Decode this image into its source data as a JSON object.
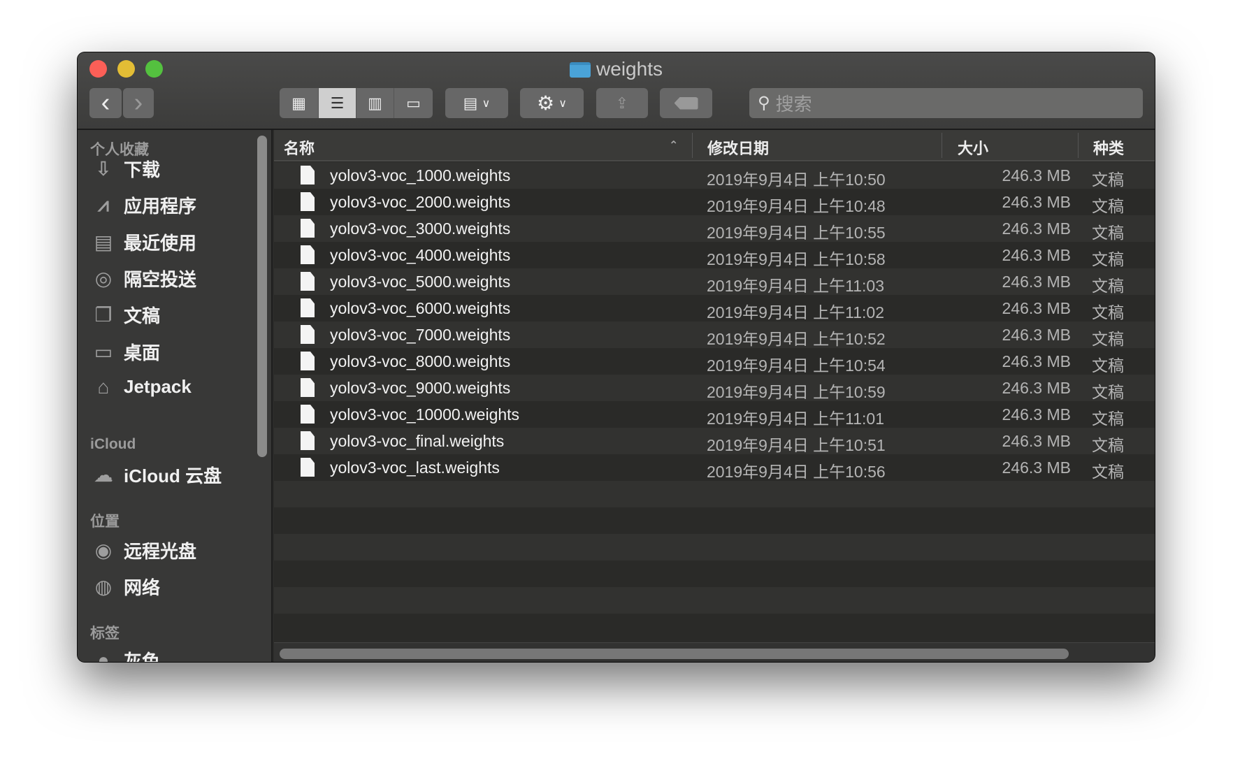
{
  "window": {
    "title": "weights",
    "traffic_lights": [
      "#fc5f57",
      "#e3bd35",
      "#54c13f"
    ]
  },
  "toolbar": {
    "back": "‹",
    "forward": "›",
    "views": [
      "icon-view",
      "list-view",
      "column-view",
      "gallery-view"
    ],
    "selected_view": "list-view",
    "arrange": "group-icon",
    "action": "gear-icon",
    "share": "share-icon",
    "tag": "tag-icon",
    "search_placeholder": "搜索"
  },
  "sidebar": {
    "favorites_heading": "个人收藏",
    "favorites": [
      {
        "label": "下载",
        "icon": "download-icon"
      },
      {
        "label": "应用程序",
        "icon": "applications-icon"
      },
      {
        "label": "最近使用",
        "icon": "recents-icon"
      },
      {
        "label": "隔空投送",
        "icon": "airdrop-icon"
      },
      {
        "label": "文稿",
        "icon": "documents-icon"
      },
      {
        "label": "桌面",
        "icon": "desktop-icon"
      },
      {
        "label": "Jetpack",
        "icon": "home-icon"
      }
    ],
    "icloud_heading": "iCloud",
    "icloud": [
      {
        "label": "iCloud 云盘",
        "icon": "cloud-icon"
      }
    ],
    "locations_heading": "位置",
    "locations": [
      {
        "label": "远程光盘",
        "icon": "disc-icon"
      },
      {
        "label": "网络",
        "icon": "network-icon"
      }
    ],
    "tags_heading": "标签",
    "tags": [
      {
        "label": "灰色",
        "icon": "gray-tag-icon"
      }
    ]
  },
  "columns": {
    "name": "名称",
    "date": "修改日期",
    "size": "大小",
    "kind": "种类",
    "sort": "name-ascending"
  },
  "files": [
    {
      "name": "yolov3-voc_1000.weights",
      "date": "2019年9月4日 上午10:50",
      "size": "246.3 MB",
      "kind": "文稿"
    },
    {
      "name": "yolov3-voc_2000.weights",
      "date": "2019年9月4日 上午10:48",
      "size": "246.3 MB",
      "kind": "文稿"
    },
    {
      "name": "yolov3-voc_3000.weights",
      "date": "2019年9月4日 上午10:55",
      "size": "246.3 MB",
      "kind": "文稿"
    },
    {
      "name": "yolov3-voc_4000.weights",
      "date": "2019年9月4日 上午10:58",
      "size": "246.3 MB",
      "kind": "文稿"
    },
    {
      "name": "yolov3-voc_5000.weights",
      "date": "2019年9月4日 上午11:03",
      "size": "246.3 MB",
      "kind": "文稿"
    },
    {
      "name": "yolov3-voc_6000.weights",
      "date": "2019年9月4日 上午11:02",
      "size": "246.3 MB",
      "kind": "文稿"
    },
    {
      "name": "yolov3-voc_7000.weights",
      "date": "2019年9月4日 上午10:52",
      "size": "246.3 MB",
      "kind": "文稿"
    },
    {
      "name": "yolov3-voc_8000.weights",
      "date": "2019年9月4日 上午10:54",
      "size": "246.3 MB",
      "kind": "文稿"
    },
    {
      "name": "yolov3-voc_9000.weights",
      "date": "2019年9月4日 上午10:59",
      "size": "246.3 MB",
      "kind": "文稿"
    },
    {
      "name": "yolov3-voc_10000.weights",
      "date": "2019年9月4日 上午11:01",
      "size": "246.3 MB",
      "kind": "文稿"
    },
    {
      "name": "yolov3-voc_final.weights",
      "date": "2019年9月4日 上午10:51",
      "size": "246.3 MB",
      "kind": "文稿"
    },
    {
      "name": "yolov3-voc_last.weights",
      "date": "2019年9月4日 上午10:56",
      "size": "246.3 MB",
      "kind": "文稿"
    }
  ]
}
